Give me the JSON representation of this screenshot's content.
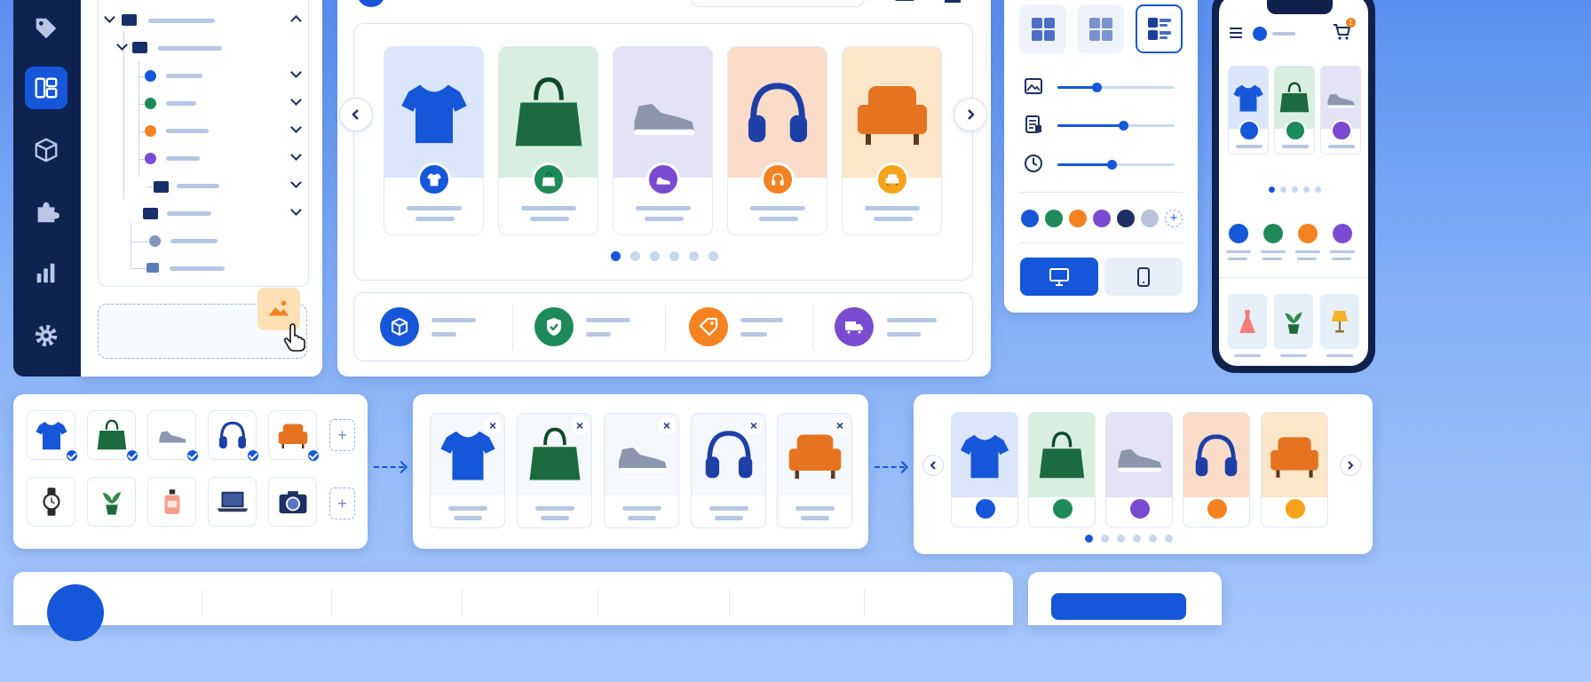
{
  "colors": {
    "accent": "#1656d9",
    "navy": "#0e2350",
    "green": "#1e8a5a",
    "orange": "#f58220",
    "purple": "#7a4bd0",
    "dark_navy": "#1d2f63",
    "light_grey": "#b7c3d8",
    "tile_blue": "#dbe5fb",
    "tile_green": "#d8eee1",
    "tile_lavender": "#e3e2f7",
    "tile_peach": "#fadcc9",
    "tile_cream": "#fbe6c9"
  },
  "sidebar": {
    "items": [
      {
        "icon": "tag-icon"
      },
      {
        "icon": "layout-icon",
        "active": true
      },
      {
        "icon": "cube-icon"
      },
      {
        "icon": "puzzle-icon"
      },
      {
        "icon": "bar-chart-icon"
      },
      {
        "icon": "gear-icon"
      }
    ]
  },
  "tree": {
    "nodes": [
      "folder",
      "folder",
      "blue-item",
      "green-item",
      "orange-item",
      "purple-item",
      "subfolder",
      "folder",
      "grey-item",
      "grey-folder"
    ]
  },
  "carousel": {
    "products": [
      {
        "name": "t-shirt",
        "icon": "shirt-icon",
        "badge_color": "#1656d9"
      },
      {
        "name": "handbag",
        "icon": "bag-icon",
        "badge_color": "#1e8a5a"
      },
      {
        "name": "sneaker",
        "icon": "sneaker-icon",
        "badge_color": "#7a4bd0"
      },
      {
        "name": "headphones",
        "icon": "headphones-icon",
        "badge_color": "#f58220"
      },
      {
        "name": "armchair",
        "icon": "armchair-icon",
        "badge_color": "#f7a21b"
      }
    ],
    "page_count": 6,
    "active_page": 1
  },
  "features": [
    {
      "icon": "box-icon",
      "color": "#1656d9"
    },
    {
      "icon": "shield-check-icon",
      "color": "#1e8a5a"
    },
    {
      "icon": "tag-icon",
      "color": "#f58220"
    },
    {
      "icon": "truck-icon",
      "color": "#7a4bd0"
    }
  ],
  "settings": {
    "sliders": [
      {
        "icon": "image-icon",
        "value": 0.33
      },
      {
        "icon": "receipt-icon",
        "value": 0.56
      },
      {
        "icon": "clock-icon",
        "value": 0.46
      }
    ],
    "swatches": [
      "#1656d9",
      "#1e8a5a",
      "#f58220",
      "#7a4bd0",
      "#1d2f63",
      "#b7c3d8"
    ],
    "devices": [
      {
        "icon": "desktop-icon",
        "active": true
      },
      {
        "icon": "phone-icon",
        "active": false
      }
    ]
  },
  "phone": {
    "cart_badge": "1",
    "bottom_products": [
      "dress",
      "plant",
      "lamp"
    ]
  },
  "selection": {
    "row1": [
      "t-shirt",
      "handbag",
      "sneaker",
      "headphones",
      "armchair"
    ],
    "row2": [
      "watch",
      "plant",
      "perfume",
      "laptop",
      "camera"
    ]
  },
  "edit": {
    "items": [
      "t-shirt",
      "handbag",
      "sneaker",
      "headphones",
      "armchair"
    ]
  },
  "preview": {
    "items": [
      "t-shirt",
      "handbag",
      "sneaker",
      "headphones",
      "armchair"
    ],
    "page_count": 6,
    "active_page": 1
  }
}
